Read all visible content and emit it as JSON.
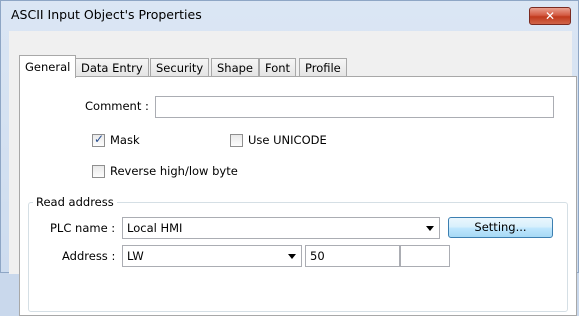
{
  "window": {
    "title": "ASCII Input Object's Properties",
    "close_glyph": "✕"
  },
  "tabs": [
    {
      "label": "General",
      "active": true
    },
    {
      "label": "Data Entry",
      "active": false
    },
    {
      "label": "Security",
      "active": false
    },
    {
      "label": "Shape",
      "active": false
    },
    {
      "label": "Font",
      "active": false
    },
    {
      "label": "Profile",
      "active": false
    }
  ],
  "general": {
    "comment_label": "Comment :",
    "comment_value": "",
    "mask_label": "Mask",
    "mask_checked": true,
    "unicode_label": "Use UNICODE",
    "unicode_checked": false,
    "reverse_label": "Reverse high/low byte",
    "reverse_checked": false
  },
  "read_address": {
    "group_title": "Read address",
    "plc_label": "PLC name :",
    "plc_value": "Local HMI",
    "setting_button": "Setting...",
    "address_label": "Address :",
    "address_type": "LW",
    "address_value": "50",
    "address_extra": ""
  },
  "icons": {
    "check_mark": "✓"
  },
  "colors": {
    "title_bar": "#cddcef",
    "close_button": "#c13a1d",
    "panel_bg": "#ffffff",
    "setting_button": "#bee6fd"
  }
}
